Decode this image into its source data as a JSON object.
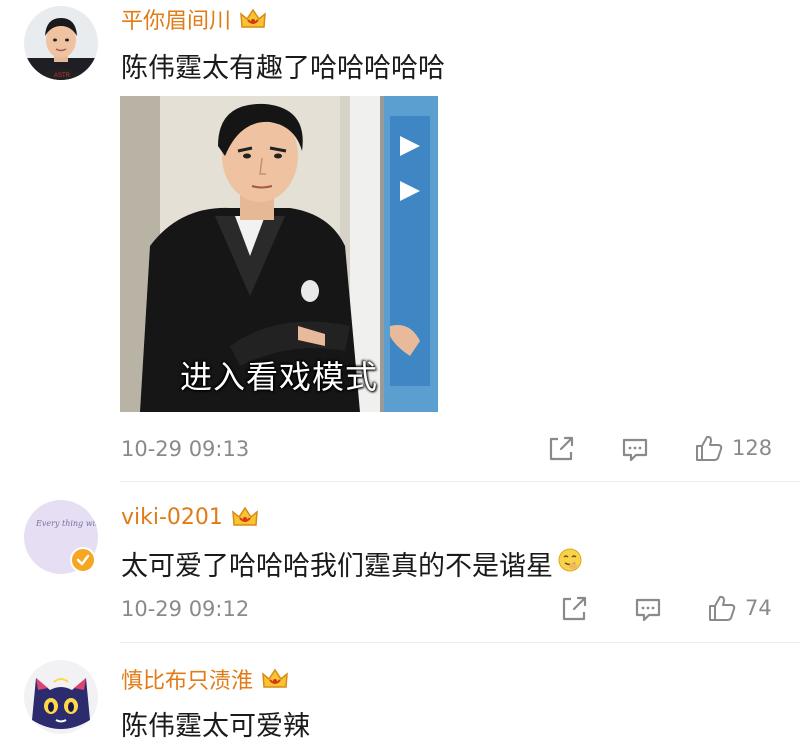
{
  "comments": [
    {
      "username": "平你眉间川",
      "text": "陈伟霆太有趣了哈哈哈哈哈",
      "image_caption": "进入看戏模式",
      "timestamp": "10-29 09:13",
      "likes": "128"
    },
    {
      "username": "viki-0201",
      "text": "太可爱了哈哈哈我们霆真的不是谐星",
      "avatar_text": "Every thing will be okay",
      "timestamp": "10-29 09:12",
      "likes": "74"
    },
    {
      "username": "慎比布只渍淮",
      "text": "陈伟霆太可爱辣"
    }
  ],
  "colors": {
    "username": "#e07b17",
    "meta": "#8a8a8a",
    "text": "#1a1a1a",
    "badge": "#f5a623"
  },
  "icons": [
    "crown-badge-icon",
    "share-icon",
    "comment-icon",
    "like-icon",
    "verified-icon",
    "emoji-icon"
  ]
}
